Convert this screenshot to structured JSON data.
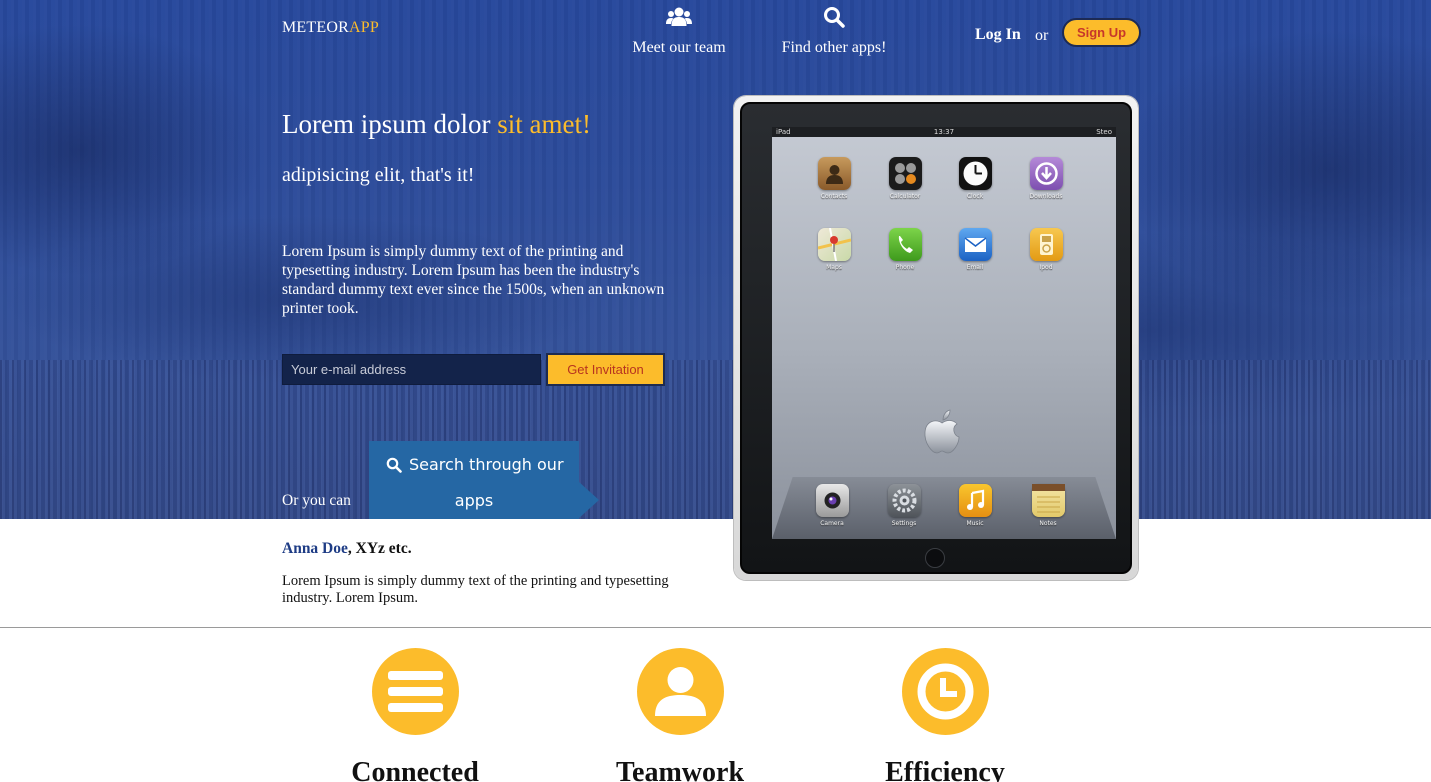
{
  "brand": {
    "main": "METEOR",
    "accent": "APP"
  },
  "nav": {
    "team": {
      "label": "Meet our team",
      "icon": "users-icon"
    },
    "find": {
      "label": "Find other apps!",
      "icon": "search-icon"
    },
    "login": "Log In",
    "or": "or",
    "signup": "Sign Up"
  },
  "hero": {
    "headline_main": "Lorem ipsum dolor ",
    "headline_accent": "sit amet!",
    "subhead": "adipisicing elit, that's it!",
    "paragraph": "Lorem Ipsum is simply dummy text of the printing and typesetting industry. Lorem Ipsum has been the industry's standard dummy text ever since the 1500s, when an unknown printer took.",
    "email_placeholder": "Your e-mail address",
    "invite_label": "Get Invitation",
    "or_you_can": "Or you can",
    "search_line1": "Search through our",
    "search_line2": "apps"
  },
  "testimonial": {
    "name": "Anna Doe",
    "rest": ", XYz etc.",
    "text": "Lorem Ipsum is simply dummy text of the printing and typesetting industry. Lorem Ipsum."
  },
  "ipad": {
    "status_left": "iPad",
    "status_time": "13:37",
    "status_right": "Steo",
    "apps": [
      {
        "label": "Contacts",
        "icon": "contacts-icon"
      },
      {
        "label": "Calculator",
        "icon": "calculator-icon"
      },
      {
        "label": "Clock",
        "icon": "clock-icon"
      },
      {
        "label": "Downloads",
        "icon": "downloads-icon"
      },
      {
        "label": "Maps",
        "icon": "maps-icon"
      },
      {
        "label": "Phone",
        "icon": "phone-icon"
      },
      {
        "label": "Email",
        "icon": "email-icon"
      },
      {
        "label": "Ipod",
        "icon": "ipod-icon"
      }
    ],
    "dock": [
      {
        "label": "Camera",
        "icon": "camera-icon"
      },
      {
        "label": "Settings",
        "icon": "settings-icon"
      },
      {
        "label": "Music",
        "icon": "music-icon"
      },
      {
        "label": "Notes",
        "icon": "notes-icon"
      }
    ]
  },
  "features": [
    {
      "title": "Connected",
      "icon": "menu-lines-icon"
    },
    {
      "title": "Teamwork",
      "icon": "user-icon"
    },
    {
      "title": "Efficiency",
      "icon": "clock-icon"
    }
  ],
  "colors": {
    "accent": "#fcbc2b",
    "hero_blue": "#2c4b9a",
    "button_blue": "#2567a4"
  }
}
